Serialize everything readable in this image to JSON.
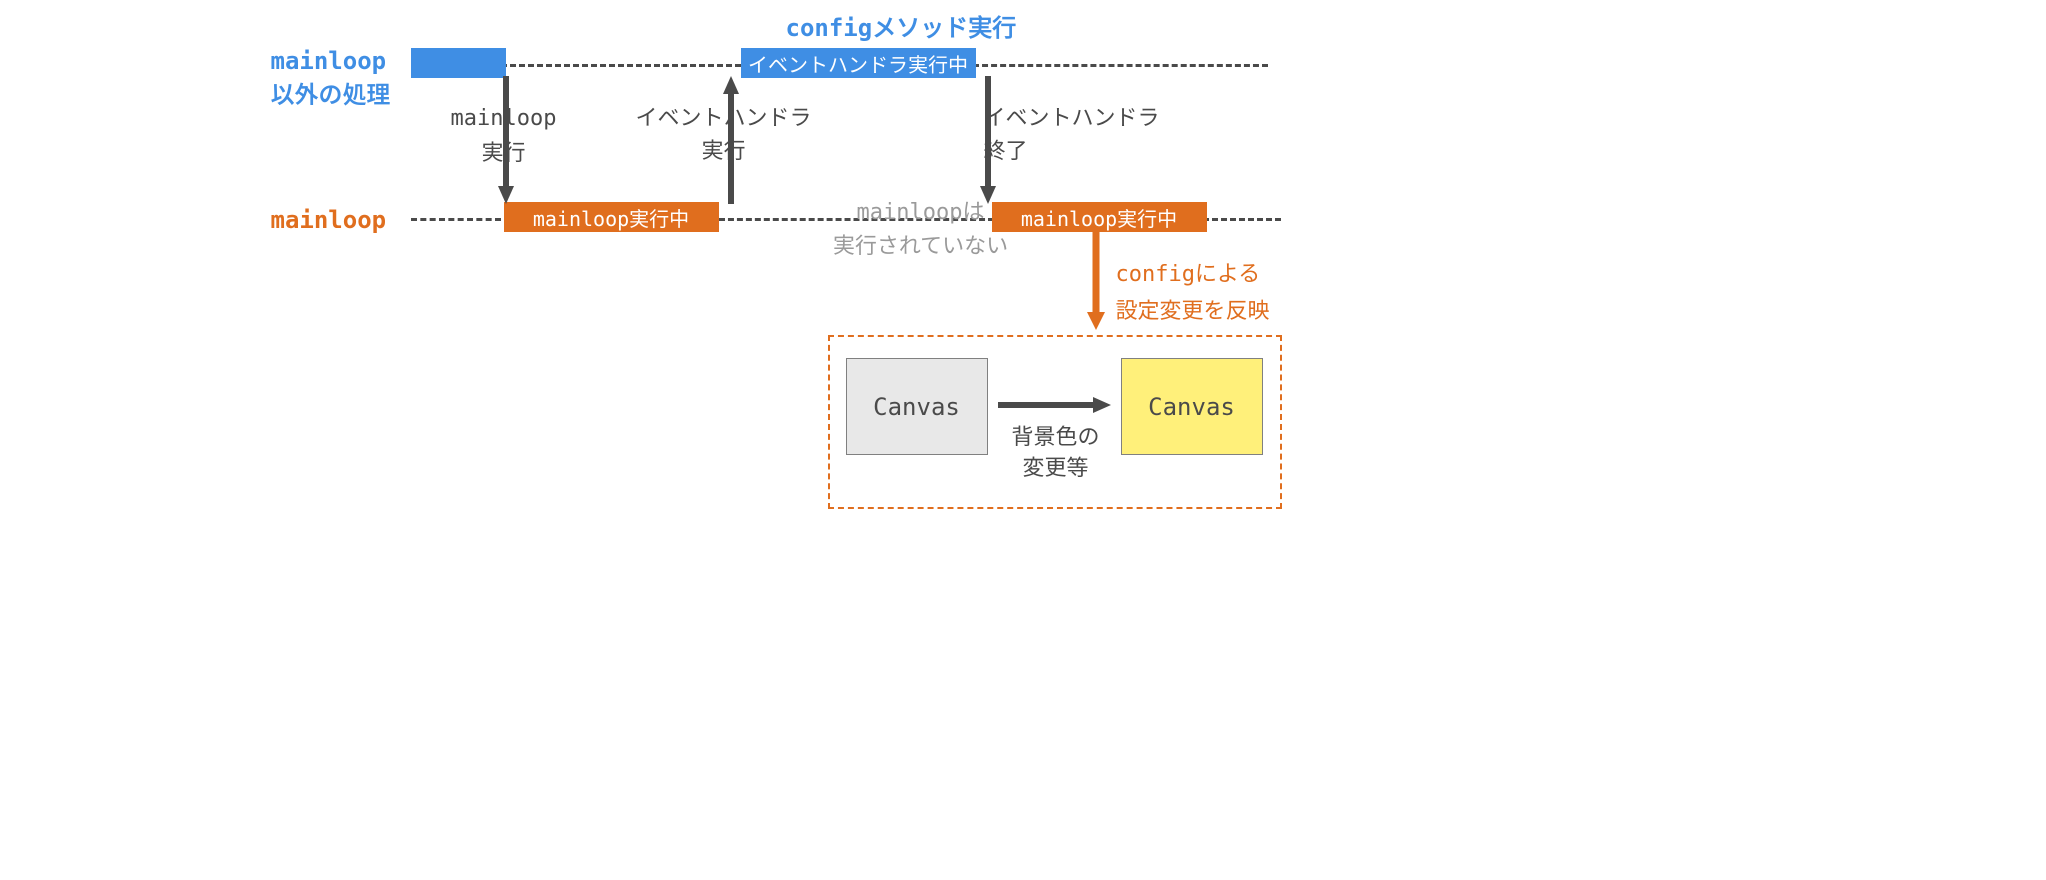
{
  "colors": {
    "blue": "#3F8EE4",
    "orange": "#E06E1E",
    "grey": "#4a4a4a",
    "muted": "#9a9a9a"
  },
  "top_title": "configメソッド実行",
  "lane_labels": {
    "outside": {
      "line1": "mainloop",
      "line2": "以外の処理"
    },
    "mainloop": "mainloop"
  },
  "bars": {
    "blue_start": "",
    "blue_handler": "イベントハンドラ実行中",
    "orange_run1": "mainloop実行中",
    "orange_run2": "mainloop実行中"
  },
  "arrow_texts": {
    "down1": {
      "line1": "mainloop",
      "line2": "実行"
    },
    "up1": {
      "line1": "イベントハンドラ",
      "line2": "実行"
    },
    "down2": {
      "line1": "イベントハンドラ",
      "line2": "終了"
    }
  },
  "mid_note": {
    "line1": "mainloopは",
    "line2": "実行されていない"
  },
  "config_note": {
    "line1": "configによる",
    "line2": "設定変更を反映"
  },
  "canvas_label": "Canvas",
  "change_label": {
    "line1": "背景色の",
    "line2": "変更等"
  }
}
